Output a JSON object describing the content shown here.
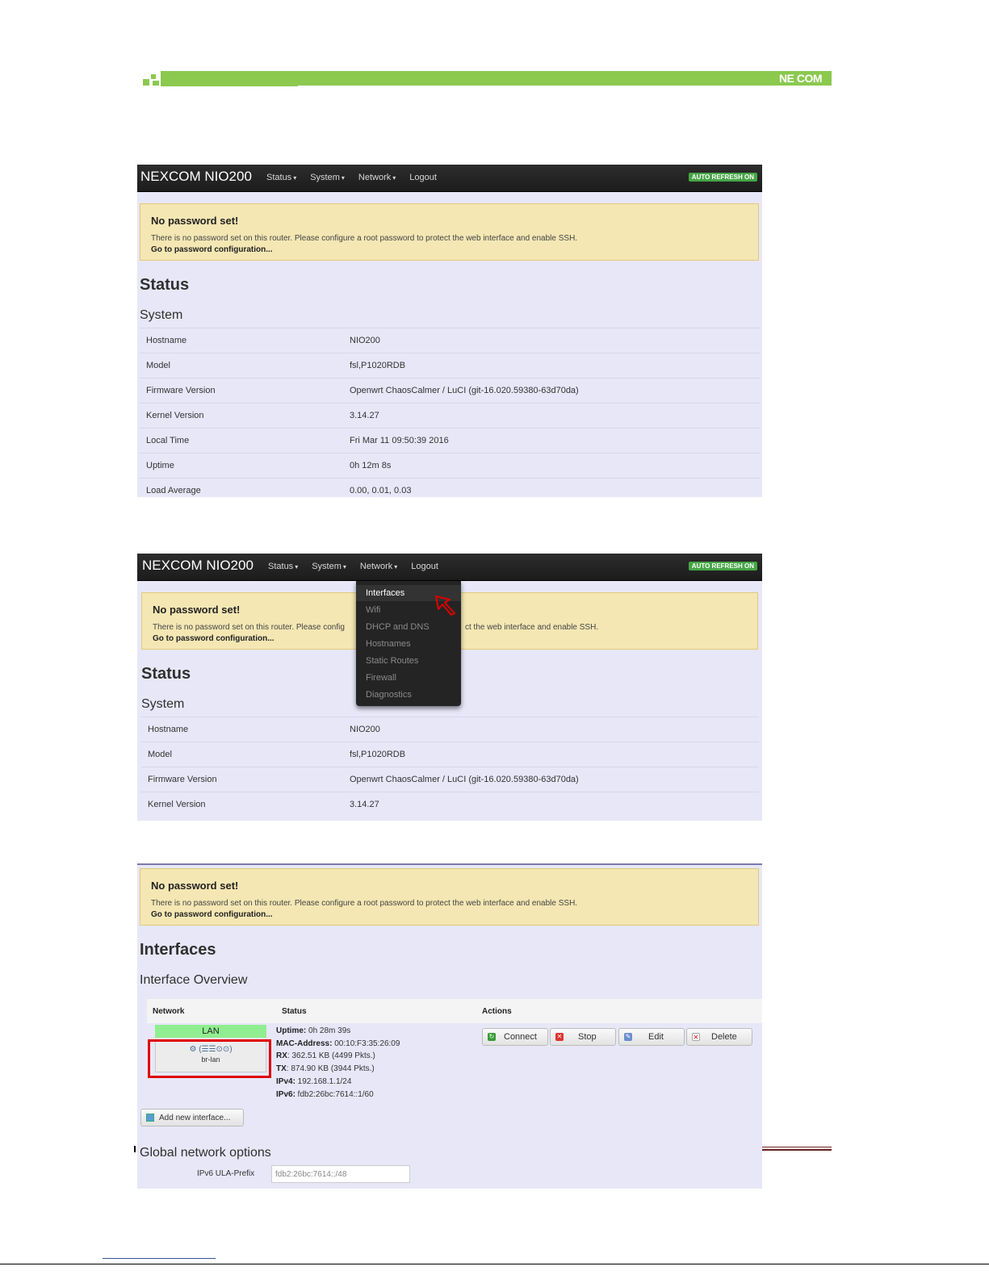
{
  "doc": {
    "logo": "NE COM"
  },
  "panel1": {
    "brand": "NEXCOM NIO200",
    "nav": [
      "Status",
      "System",
      "Network",
      "Logout"
    ],
    "badge": "AUTO REFRESH ON",
    "alert": {
      "title": "No password set!",
      "text": "There is no password set on this router. Please configure a root password to protect the web interface and enable SSH.",
      "link": "Go to password configuration..."
    },
    "heading": "Status",
    "subheading": "System",
    "rows": [
      {
        "key": "Hostname",
        "value": "NIO200"
      },
      {
        "key": "Model",
        "value": "fsl,P1020RDB"
      },
      {
        "key": "Firmware Version",
        "value": "Openwrt ChaosCalmer / LuCI (git-16.020.59380-63d70da)"
      },
      {
        "key": "Kernel Version",
        "value": "3.14.27"
      },
      {
        "key": "Local Time",
        "value": "Fri Mar 11 09:50:39 2016"
      },
      {
        "key": "Uptime",
        "value": "0h 12m 8s"
      },
      {
        "key": "Load Average",
        "value": "0.00, 0.01, 0.03"
      }
    ]
  },
  "panel2": {
    "brand": "NEXCOM NIO200",
    "nav": [
      "Status",
      "System",
      "Network",
      "Logout"
    ],
    "badge": "AUTO REFRESH ON",
    "alert": {
      "title": "No password set!",
      "text_left": "There is no password set on this router. Please config",
      "text_right": "ct the web interface and enable SSH.",
      "link": "Go to password configuration..."
    },
    "heading": "Status",
    "subheading": "System",
    "dropdown": [
      "Interfaces",
      "Wifi",
      "DHCP and DNS",
      "Hostnames",
      "Static Routes",
      "Firewall",
      "Diagnostics"
    ],
    "rows": [
      {
        "key": "Hostname",
        "value": "NIO200"
      },
      {
        "key": "Model",
        "value": "fsl,P1020RDB"
      },
      {
        "key": "Firmware Version",
        "value": "Openwrt ChaosCalmer / LuCI (git-16.020.59380-63d70da)"
      },
      {
        "key": "Kernel Version",
        "value": "3.14.27"
      }
    ]
  },
  "panel3": {
    "alert": {
      "title": "No password set!",
      "text": "There is no password set on this router. Please configure a root password to protect the web interface and enable SSH.",
      "link": "Go to password configuration..."
    },
    "heading": "Interfaces",
    "subheading": "Interface Overview",
    "columns": [
      "Network",
      "Status",
      "Actions"
    ],
    "network": {
      "name": "LAN",
      "icons": "(☰☰⊙⊙)",
      "device": "br-lan"
    },
    "status": [
      {
        "label": "Uptime:",
        "value": " 0h 28m 39s"
      },
      {
        "label": "MAC-Address:",
        "value": " 00:10:F3:35:26:09"
      },
      {
        "label": "RX",
        "value": ": 362.51 KB (4499 Pkts.)"
      },
      {
        "label": "TX",
        "value": ": 874.90 KB (3944 Pkts.)"
      },
      {
        "label": "IPv4:",
        "value": " 192.168.1.1/24"
      },
      {
        "label": "IPv6:",
        "value": " fdb2:26bc:7614::1/60"
      }
    ],
    "actions": [
      "Connect",
      "Stop",
      "Edit",
      "Delete"
    ],
    "add_button": "Add new interface...",
    "global_heading": "Global network options",
    "ula_label": "IPv6 ULA-Prefix",
    "ula_value": "fdb2:26bc:7614::/48"
  }
}
